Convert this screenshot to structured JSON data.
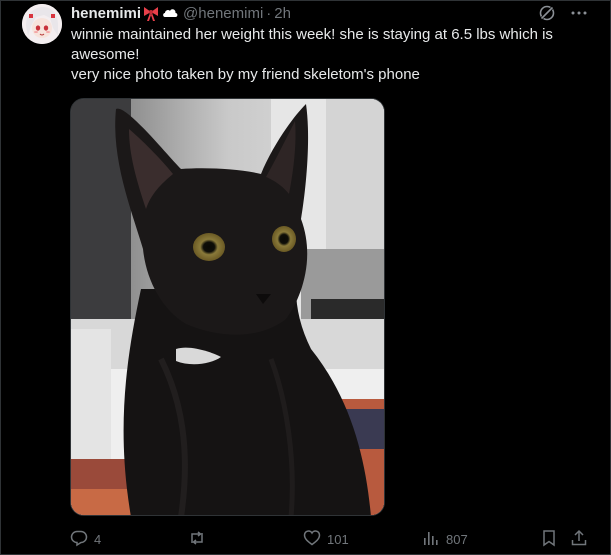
{
  "post": {
    "display_name": "henemimi",
    "handle": "@henemimi",
    "separator": "·",
    "time": "2h",
    "text_line_1": "winnie maintained her weight this week! she is staying at 6.5 lbs which is awesome!",
    "text_line_2": "very nice photo taken by my friend skeletom's phone"
  },
  "actions": {
    "reply_count": "4",
    "repost_count": "",
    "like_count": "101",
    "views_count": "807"
  },
  "icons": {
    "name_badges": [
      "bow-icon",
      "cloud-icon"
    ],
    "header": [
      "grok-icon",
      "more-icon"
    ],
    "bar": [
      "reply-icon",
      "repost-icon",
      "like-icon",
      "views-icon",
      "bookmark-icon",
      "share-icon"
    ]
  },
  "colors": {
    "background": "#000000",
    "text_primary": "#e7e9ea",
    "text_secondary": "#71767b",
    "bow": "#e8404a",
    "border": "#2f3336"
  }
}
